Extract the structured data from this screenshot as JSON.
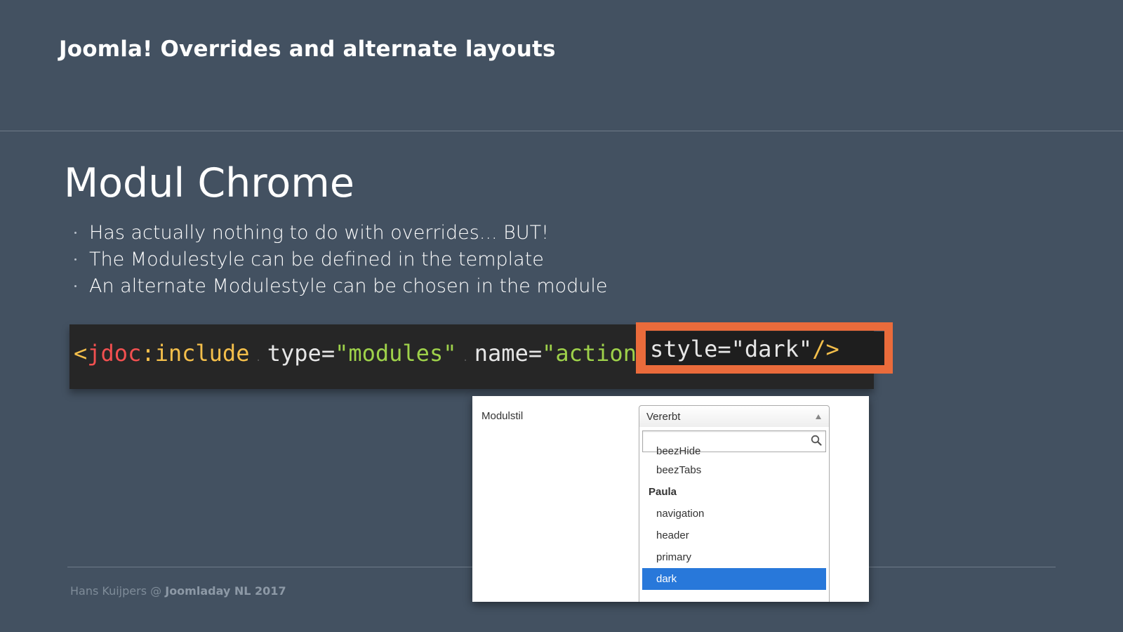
{
  "header": {
    "title": "Joomla! Overrides and alternate layouts"
  },
  "slide": {
    "title": "Modul Chrome",
    "bullets": [
      "Has actually nothing to do with overrides... BUT!",
      "The Modulestyle can be defined in the template",
      "An alternate Modulestyle can be chosen in the module"
    ]
  },
  "code": {
    "open": "<",
    "tag": "jdoc",
    "colon": ":",
    "fn": "include",
    "type_attr": "type=",
    "type_val": "\"modules\"",
    "name_attr": "name=",
    "name_val": "\"action\"",
    "style_attr": "style=",
    "style_val": "\"dark\"",
    "close": "/>"
  },
  "panel": {
    "label": "Modulstil",
    "select_value": "Vererbt",
    "search_value": "",
    "options": [
      {
        "label": "beezHide",
        "kind": "child"
      },
      {
        "label": "beezTabs",
        "kind": "child"
      },
      {
        "label": "Paula",
        "kind": "group"
      },
      {
        "label": "navigation",
        "kind": "child"
      },
      {
        "label": "header",
        "kind": "child"
      },
      {
        "label": "primary",
        "kind": "child"
      },
      {
        "label": "dark",
        "kind": "child-selected"
      }
    ]
  },
  "footer": {
    "author": "Hans Kuijpers",
    "at": "@",
    "event": "Joomladay NL 2017"
  },
  "colors": {
    "background": "#435161",
    "highlight": "#ea6b3b",
    "selected_option": "#2878da",
    "code_bg": "#262626"
  }
}
